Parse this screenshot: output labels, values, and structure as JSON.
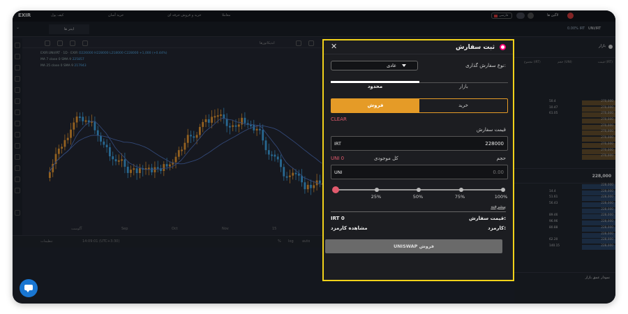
{
  "topbar": {
    "logo": "EXIR",
    "nav": [
      "خرید و فروش حرفه ای",
      "خرید آسان",
      "کیف پول",
      "معاملا"
    ],
    "language": "فارسی",
    "login_label": "لاگین ها"
  },
  "tabs_row": {
    "tab": "اینتر ها",
    "right_text": "0.00% IRT",
    "pair": "UNI/IRT"
  },
  "chart": {
    "toolbar_label": "اندیکاتورها",
    "legend": {
      "symbol": "EXIR:UNI/IRT · 1D · EXIR",
      "ohlc": "O226000 H228000 L218000 C228000 +1,000 (+0.44%)",
      "ma1": "MA 7 close 0 SMA 9",
      "ma1_val": "225857",
      "ma2": "MA 25 close 0 SMA 9",
      "ma2_val": "217943"
    },
    "x_labels": [
      "آگوست",
      "Sep",
      "Oct",
      "Nov",
      "15",
      "دسامبر"
    ],
    "bottom_items": [
      "تنظیمات",
      "14:09:01 (UTC+3:30)",
      "%",
      "log",
      "auto"
    ],
    "colors": {
      "up": "#e8952a",
      "down": "#3aa0e0",
      "ma": "#4b6cb7"
    }
  },
  "orderbook": {
    "title": "بازار",
    "cols": [
      "قیمت (IRT)",
      "حجم (UNI)",
      "مجموع (IRT)"
    ],
    "asks": [
      [
        "50.4",
        "270,000"
      ],
      [
        "10.47",
        "270,000"
      ],
      [
        "61.05",
        "270,000"
      ],
      [
        "",
        "270,000"
      ],
      [
        "",
        "270,000"
      ],
      [
        "",
        "270,000"
      ],
      [
        "",
        "270,000"
      ],
      [
        "",
        "270,000"
      ],
      [
        "",
        "270,000"
      ],
      [
        "",
        "270,000"
      ]
    ],
    "last_price": "228,000",
    "bids": [
      [
        "",
        "228,000"
      ],
      [
        "14.4",
        "228,000"
      ],
      [
        "51.61",
        "228,000"
      ],
      [
        "56.43",
        "228,000"
      ],
      [
        "",
        "228,000"
      ],
      [
        "89.46",
        "228,000"
      ],
      [
        "96.96",
        "228,000"
      ],
      [
        "80.88",
        "228,000"
      ],
      [
        "",
        "228,000"
      ],
      [
        "62.20",
        "228,000"
      ],
      [
        "140.15",
        "228,000"
      ]
    ],
    "depth_title": "نمودار عمق بازار"
  },
  "modal": {
    "title": "ثبت سفارش",
    "order_type_label": "نوع سفارش گذاری:",
    "order_type_value": "عادی",
    "tabs": [
      "بازار",
      "محدود"
    ],
    "active_tab": "محدود",
    "sides": [
      "فروش",
      "خرید"
    ],
    "active_side": "فروش",
    "clear_label": "CLEAR",
    "price_label": "قیمت سفارش",
    "price_unit": "IRT",
    "price_value": "228000",
    "volume_label": "حجم",
    "balance_label": "کل موجودی",
    "balance_value": "UNI 0",
    "volume_unit": "UNI",
    "volume_placeholder": "0.00",
    "slider_percent": 0,
    "slider_marks": [
      "25%",
      "50%",
      "75%",
      "100%"
    ],
    "advanced_label": "پیشرفته",
    "order_price_label": "قیمت سفارش:",
    "order_price_value": "IRT 0",
    "fee_label": "کارمزد:",
    "fee_value": "مشاهده کارمزد",
    "submit_label": "UNISWAP فروش",
    "accent_sell": "#e59b27",
    "accent_clear": "#e25a6d",
    "highlight_border": "#f1d21a"
  }
}
